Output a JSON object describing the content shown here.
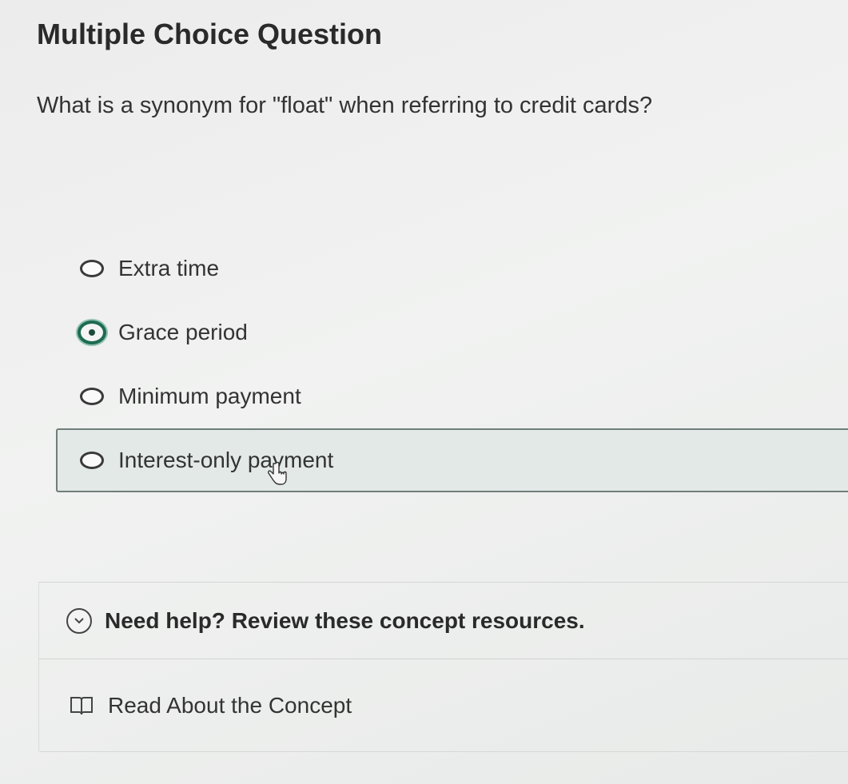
{
  "question": {
    "heading": "Multiple Choice Question",
    "prompt": "What is a synonym for \"float\" when referring to credit cards?"
  },
  "options": [
    {
      "label": "Extra time",
      "selected": false
    },
    {
      "label": "Grace period",
      "selected": true
    },
    {
      "label": "Minimum payment",
      "selected": false
    },
    {
      "label": "Interest-only payment",
      "selected": false
    }
  ],
  "help": {
    "toggle_label": "Need help? Review these concept resources.",
    "resource_label": "Read About the Concept"
  },
  "icons": {
    "help_toggle": "chevron-down-circle-icon",
    "resource": "book-icon",
    "pointer": "hand-cursor-icon"
  },
  "colors": {
    "selected_ring": "#1d6b52",
    "hover_bg": "#e3e9e7"
  }
}
